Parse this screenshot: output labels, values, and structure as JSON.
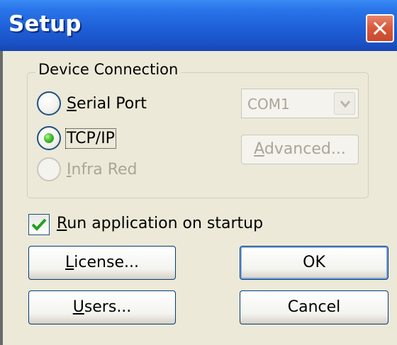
{
  "window": {
    "title": "Setup",
    "colors": {
      "titlebar": "#1e5fd8",
      "body": "#ece9d8",
      "close": "#d9573a",
      "radio_selected": "#43c02e"
    }
  },
  "device_connection": {
    "legend": "Device Connection",
    "options": [
      {
        "label": "Serial Port",
        "mnemonic": "S",
        "rest": "erial Port",
        "selected": false,
        "enabled": true
      },
      {
        "label": "TCP/IP",
        "mnemonic": "",
        "rest": "TCP/IP",
        "selected": true,
        "enabled": true
      },
      {
        "label": "Infra Red",
        "mnemonic": "I",
        "rest": "nfra Red",
        "selected": false,
        "enabled": false
      }
    ],
    "port_select": {
      "value": "COM1",
      "enabled": false
    },
    "advanced_button": {
      "label": "Advanced...",
      "mnemonic": "A",
      "rest": "dvanced...",
      "enabled": false
    }
  },
  "run_on_startup": {
    "label": "Run application on startup",
    "mnemonic": "R",
    "rest": "un application on startup",
    "checked": true
  },
  "buttons": {
    "license": {
      "label": "License...",
      "mnemonic": "L",
      "rest": "icense..."
    },
    "users": {
      "label": "Users...",
      "mnemonic": "U",
      "rest": "sers..."
    },
    "ok": {
      "label": "OK"
    },
    "cancel": {
      "label": "Cancel"
    }
  },
  "icons": {
    "close": "close-icon",
    "dropdown": "chevron-down-icon",
    "check": "checkmark-icon"
  }
}
